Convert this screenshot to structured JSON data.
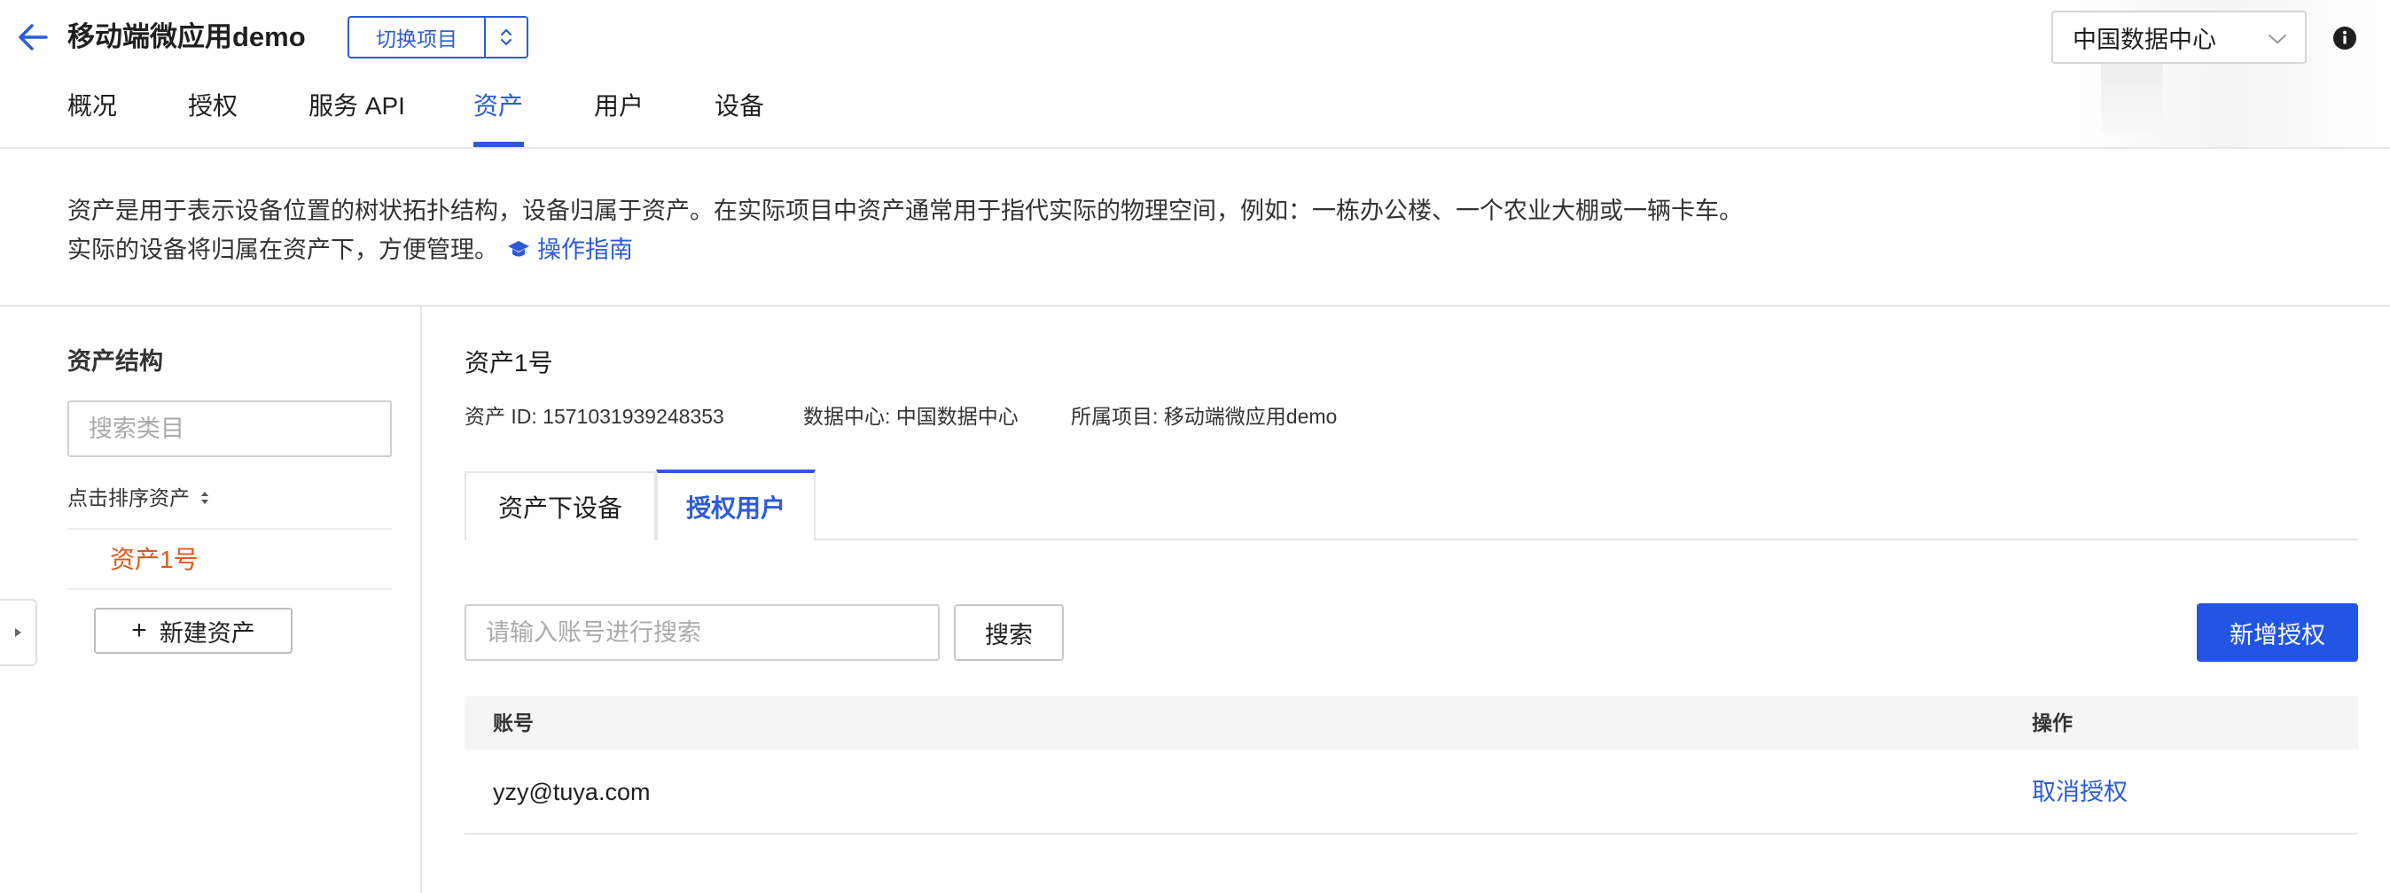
{
  "header": {
    "app_title": "移动端微应用demo",
    "switch_project_label": "切换项目",
    "data_center": "中国数据中心",
    "icons": {
      "back": "arrow-left-icon",
      "switch": "up-down-icon",
      "dropdown": "chevron-down-icon",
      "info": "info-icon"
    }
  },
  "nav": {
    "tabs": [
      {
        "label": "概况"
      },
      {
        "label": "授权"
      },
      {
        "label": "服务 API"
      },
      {
        "label": "资产"
      },
      {
        "label": "用户"
      },
      {
        "label": "设备"
      }
    ],
    "active": "资产"
  },
  "description": {
    "line1": "资产是用于表示设备位置的树状拓扑结构，设备归属于资产。在实际项目中资产通常用于指代实际的物理空间，例如：一栋办公楼、一个农业大棚或一辆卡车。",
    "line2": "实际的设备将归属在资产下，方便管理。",
    "guide_link": "操作指南"
  },
  "left_panel": {
    "title": "资产结构",
    "search_placeholder": "搜索类目",
    "sort_label": "点击排序资产",
    "tree_items": [
      {
        "label": "资产1号",
        "selected": true
      }
    ],
    "new_asset_label": "新建资产"
  },
  "detail": {
    "asset_name": "资产1号",
    "asset_id": "资产 ID: 1571031939248353",
    "data_center": "数据中心: 中国数据中心",
    "project": "所属项目: 移动端微应用demo",
    "tabs": [
      {
        "label": "资产下设备"
      },
      {
        "label": "授权用户"
      }
    ],
    "active_tab": "授权用户",
    "account_search_placeholder": "请输入账号进行搜索",
    "search_button": "搜索",
    "add_auth_button": "新增授权",
    "table": {
      "columns": [
        "账号",
        "操作"
      ],
      "rows": [
        {
          "account": "yzy@tuya.com",
          "action": "取消授权"
        }
      ]
    }
  },
  "colors": {
    "accent": "#2d5bd8",
    "primary_button": "#2255e4",
    "selected_tree_item": "#e05a1c"
  }
}
